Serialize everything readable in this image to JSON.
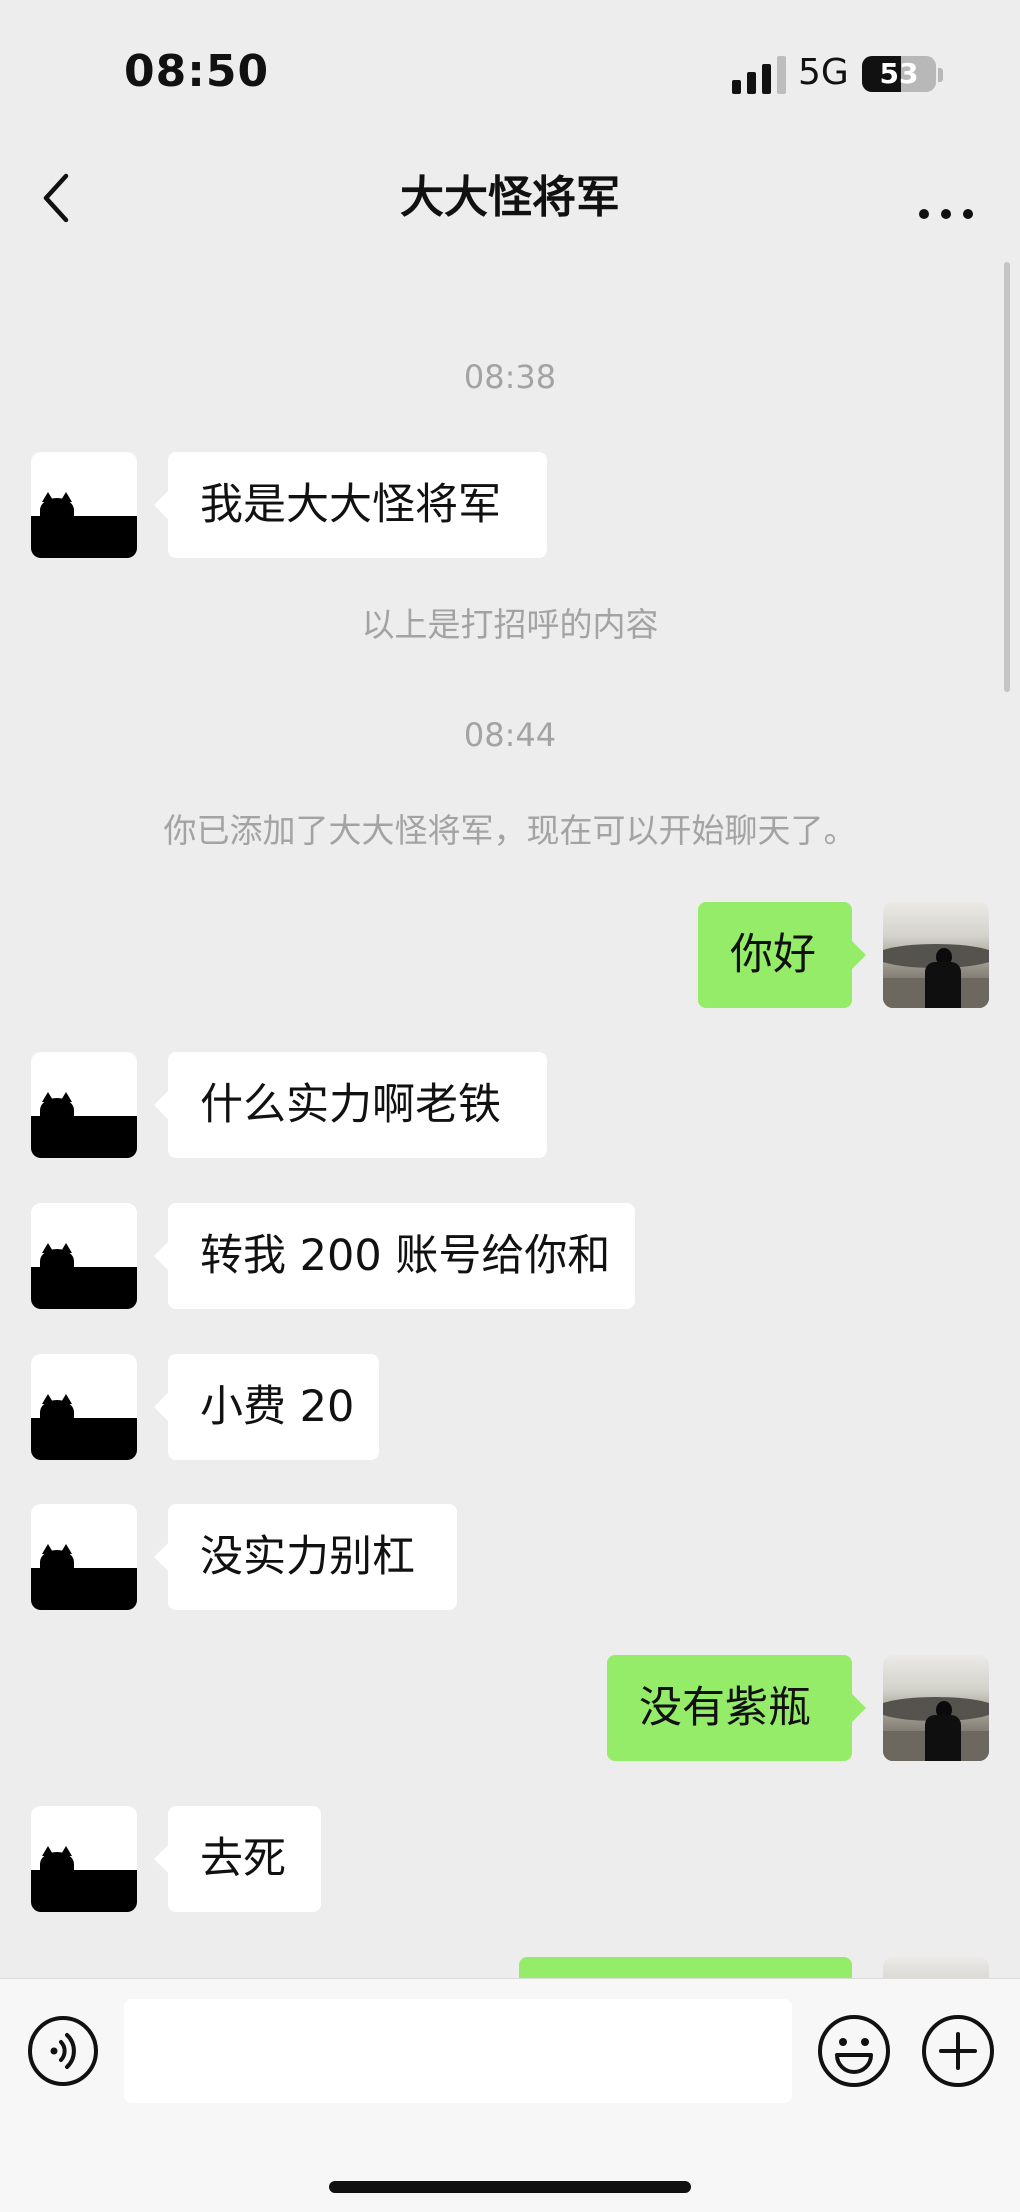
{
  "status_bar": {
    "time": "08:50",
    "network": "5G",
    "battery": "53",
    "battery_level": 0.53,
    "signal_icon": "cellular-signal-icon"
  },
  "header": {
    "title": "大大怪将军",
    "back_icon": "chevron-left-icon",
    "more_icon": "ellipsis-icon"
  },
  "chat": {
    "timestamps": [
      "08:38",
      "08:44"
    ],
    "system_messages": [
      "以上是打招呼的内容",
      "你已添加了大大怪将军，现在可以开始聊天了。"
    ],
    "messages": [
      {
        "sender": "contact",
        "text": "我是大大怪将军"
      },
      {
        "sender": "me",
        "text": "你好"
      },
      {
        "sender": "contact",
        "text": "什么实力啊老铁"
      },
      {
        "sender": "contact",
        "text": "转我 200 账号给你和"
      },
      {
        "sender": "contact",
        "text": "小费 20"
      },
      {
        "sender": "contact",
        "text": "没实力别杠"
      },
      {
        "sender": "me",
        "text": "没有紫瓶"
      },
      {
        "sender": "contact",
        "text": "去死"
      },
      {
        "sender": "me",
        "text": ""
      }
    ]
  },
  "input_bar": {
    "message_value": "",
    "voice_icon": "voice-wave-icon",
    "emoji_icon": "smiley-icon",
    "plus_icon": "plus-circle-icon"
  },
  "colors": {
    "background": "#ededed",
    "outgoing_bubble": "#95ec69",
    "incoming_bubble": "#ffffff",
    "system_text": "#a3a3a3"
  }
}
